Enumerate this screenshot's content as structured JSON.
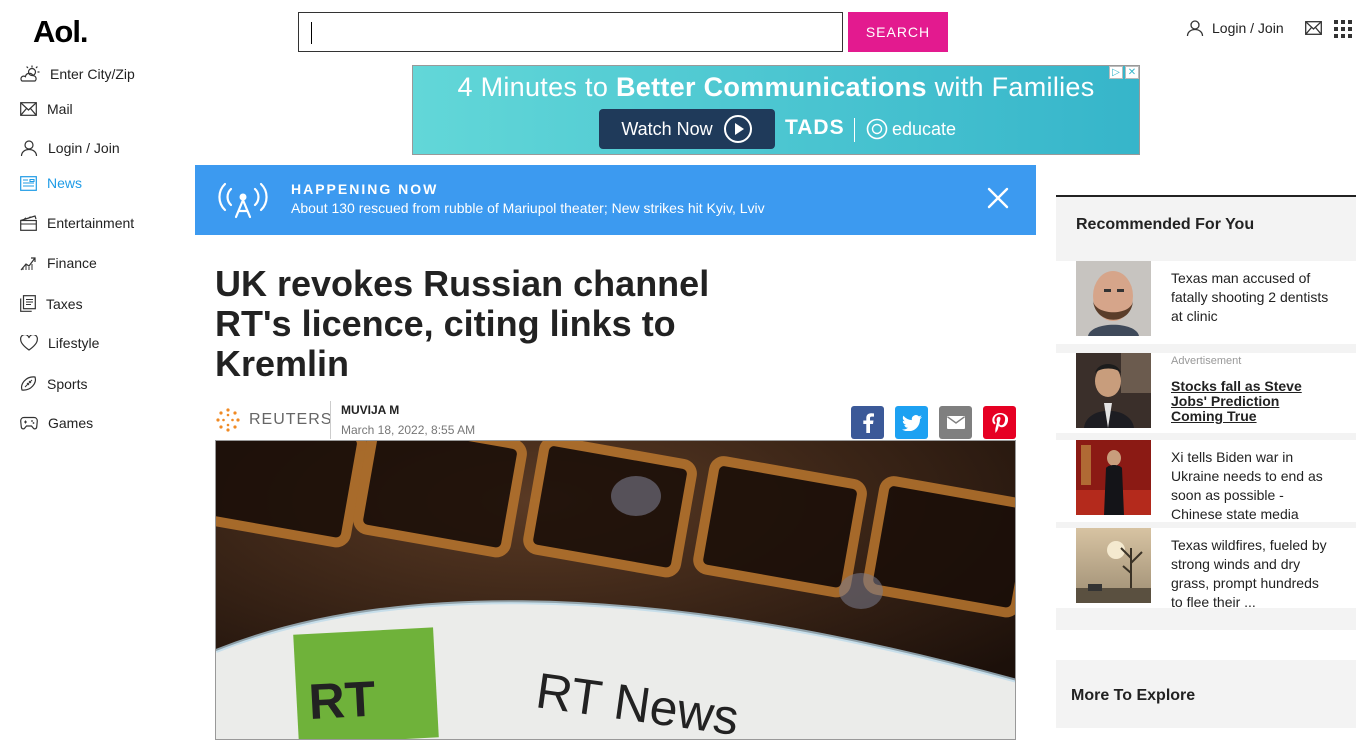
{
  "header": {
    "logo": "Aol.",
    "search_placeholder": "",
    "search_button": "SEARCH",
    "login_label": "Login / Join"
  },
  "sidebar": {
    "items": [
      {
        "label": "Enter City/Zip",
        "icon": "weather-icon"
      },
      {
        "label": "Mail",
        "icon": "mail-icon"
      },
      {
        "label": "Login / Join",
        "icon": "user-icon"
      },
      {
        "label": "News",
        "icon": "news-icon",
        "active": true
      },
      {
        "label": "Entertainment",
        "icon": "clapperboard-icon"
      },
      {
        "label": "Finance",
        "icon": "chart-icon"
      },
      {
        "label": "Taxes",
        "icon": "document-icon"
      },
      {
        "label": "Lifestyle",
        "icon": "heart-icon"
      },
      {
        "label": "Sports",
        "icon": "football-icon"
      },
      {
        "label": "Games",
        "icon": "gamepad-icon"
      }
    ]
  },
  "ad": {
    "headline_pre": "4 Minutes to",
    "headline_bold": "Better Communications",
    "headline_post": "with Families",
    "cta": "Watch Now",
    "brand1": "TADS",
    "brand2": "educate"
  },
  "happening_now": {
    "title": "HAPPENING NOW",
    "text": "About 130 rescued from rubble of Mariupol theater; New strikes hit Kyiv, Lviv"
  },
  "article": {
    "headline": "UK revokes Russian channel RT's licence, citing links to Kremlin",
    "source": "REUTERS",
    "author": "MUVIJA M",
    "date": "March 18, 2022, 8:55 AM",
    "image_caption_text": "RT News"
  },
  "rail": {
    "title": "Recommended For You",
    "items": [
      {
        "text": "Texas man accused of fatally shooting 2 dentists at clinic"
      },
      {
        "ad_label": "Advertisement",
        "text": "Stocks fall as Steve Jobs' Prediction Coming True"
      },
      {
        "text": "Xi tells Biden war in Ukraine needs to end as soon as possible - Chinese state media"
      },
      {
        "text": "Texas wildfires, fueled by strong winds and dry grass, prompt hundreds to flee their ..."
      }
    ],
    "more_title": "More To Explore"
  },
  "colors": {
    "search_button": "#e31a8f",
    "happening_bg": "#3c9af0",
    "active_nav": "#1e9be6"
  }
}
